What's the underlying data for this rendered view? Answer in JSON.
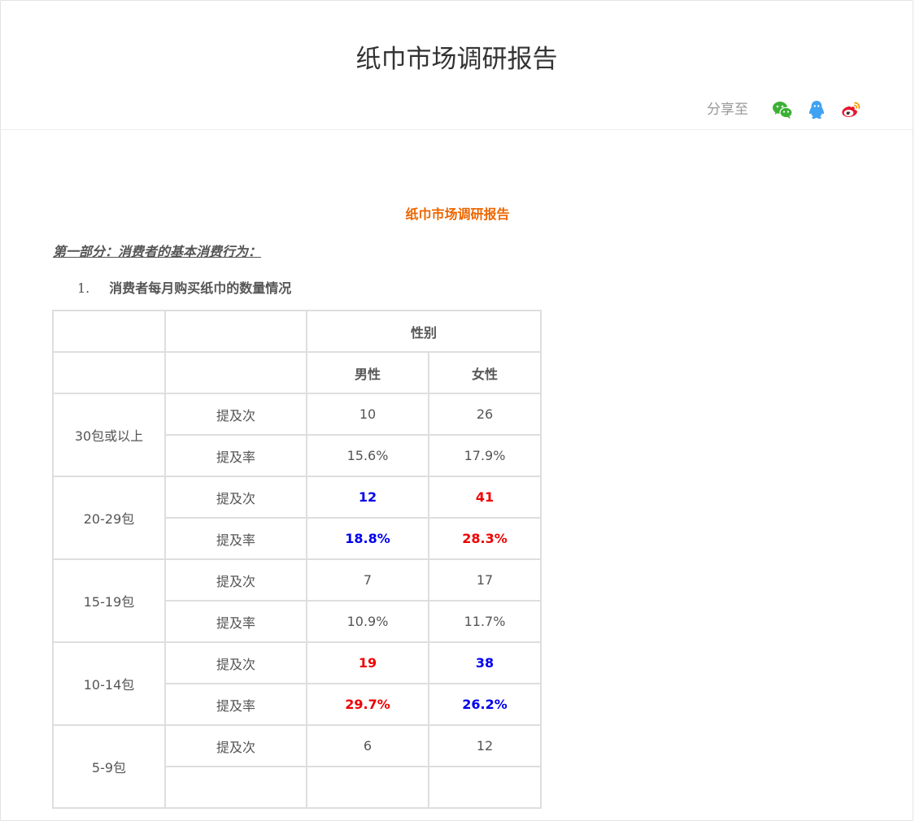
{
  "header": {
    "title": "纸巾市场调研报告",
    "share_label": "分享至",
    "share_icons": [
      "wechat-icon",
      "qq-icon",
      "weibo-icon"
    ]
  },
  "article": {
    "doc_title": "纸巾市场调研报告",
    "part_heading": "第一部分：消费者的基本消费行为：",
    "item_number": "1.",
    "item_heading": "消费者每月购买纸巾的数量情况"
  },
  "table": {
    "group_header": "性别",
    "col_headers": [
      "男性",
      "女性"
    ],
    "groups": [
      {
        "label": "30包或以上",
        "rows": [
          {
            "metric": "提及次",
            "male": "10",
            "female": "26",
            "male_color": "normal",
            "female_color": "normal"
          },
          {
            "metric": "提及率",
            "male": "15.6%",
            "female": "17.9%",
            "male_color": "normal",
            "female_color": "normal"
          }
        ]
      },
      {
        "label": "20-29包",
        "rows": [
          {
            "metric": "提及次",
            "male": "12",
            "female": "41",
            "male_color": "blue",
            "female_color": "red"
          },
          {
            "metric": "提及率",
            "male": "18.8%",
            "female": "28.3%",
            "male_color": "blue",
            "female_color": "red"
          }
        ]
      },
      {
        "label": "15-19包",
        "rows": [
          {
            "metric": "提及次",
            "male": "7",
            "female": "17",
            "male_color": "normal",
            "female_color": "normal"
          },
          {
            "metric": "提及率",
            "male": "10.9%",
            "female": "11.7%",
            "male_color": "normal",
            "female_color": "normal"
          }
        ]
      },
      {
        "label": "10-14包",
        "rows": [
          {
            "metric": "提及次",
            "male": "19",
            "female": "38",
            "male_color": "red",
            "female_color": "blue"
          },
          {
            "metric": "提及率",
            "male": "29.7%",
            "female": "26.2%",
            "male_color": "red",
            "female_color": "blue"
          }
        ]
      },
      {
        "label": "5-9包",
        "rows": [
          {
            "metric": "提及次",
            "male": "6",
            "female": "12",
            "male_color": "normal",
            "female_color": "normal"
          },
          {
            "metric": "",
            "male": "",
            "female": "",
            "male_color": "normal",
            "female_color": "normal"
          }
        ]
      }
    ]
  },
  "colors": {
    "accent_orange": "#ee6600",
    "highlight_blue": "#0000ee",
    "highlight_red": "#ee0000",
    "wechat_green": "#3cb034",
    "qq_blue": "#3fa2f2",
    "weibo_red": "#e6162d"
  }
}
